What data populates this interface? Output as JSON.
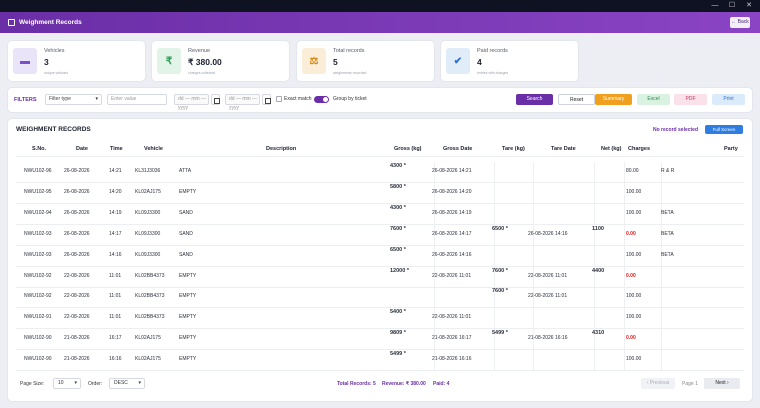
{
  "window": {
    "minimize": "—",
    "maximize": "☐",
    "close": "✕"
  },
  "app": {
    "title": "Weighment Records",
    "back_label": "← Back"
  },
  "cards": [
    {
      "label": "Vehicles",
      "value": "3",
      "sub": "unique vehicles",
      "icon": "truck-icon",
      "glyph": "▬",
      "bg": "#e9e4f7",
      "fg": "#7b4fc8"
    },
    {
      "label": "Revenue",
      "value": "₹ 380.00",
      "sub": "charges collected",
      "icon": "rupee-icon",
      "glyph": "₹",
      "bg": "#e2f3e7",
      "fg": "#2e9b55"
    },
    {
      "label": "Total records",
      "value": "5",
      "sub": "weighments recorded",
      "icon": "scale-icon",
      "glyph": "⚖",
      "bg": "#fbeed9",
      "fg": "#d98612"
    },
    {
      "label": "Paid records",
      "value": "4",
      "sub": "entries with charges",
      "icon": "check-badge-icon",
      "glyph": "✔",
      "bg": "#e1ecf9",
      "fg": "#2f6fd1"
    }
  ],
  "filters": {
    "label": "FILTERS",
    "type_placeholder": "Filter type",
    "value_placeholder": "Enter value",
    "date_from": "dd — mm — yyyy",
    "date_to": "dd — mm — yyyy",
    "exact_match": "Exact match",
    "group_by_ticket": "Group by ticket",
    "buttons": {
      "search": "Search",
      "reset": "Reset",
      "summary": "Summary",
      "excel": "Excel",
      "pdf": "PDF",
      "print": "Print"
    }
  },
  "table": {
    "title": "WEIGHMENT RECORDS",
    "no_record": "No record selected",
    "fullscreen": "Full Screen",
    "headers": [
      "S.No.",
      "Date",
      "Time",
      "Vehicle",
      "Description",
      "Gross (kg)",
      "Gross Date",
      "Tare (kg)",
      "Tare Date",
      "Net (kg)",
      "Charges",
      "Party"
    ],
    "rows": [
      {
        "sno": "NWU102-96",
        "date": "26-08-2026",
        "time": "14:21",
        "vehicle": "KL31J3036",
        "desc": "ATTA",
        "gross": "4300 *",
        "gross_date": "26-08-2026 14:21",
        "tare": "",
        "tare_date": "",
        "net": "",
        "charges": "80.00",
        "charges_red": false,
        "party": "R & R"
      },
      {
        "sno": "NWU102-95",
        "date": "26-08-2026",
        "time": "14:20",
        "vehicle": "KL02AJ175",
        "desc": "EMPTY",
        "gross": "5800 *",
        "gross_date": "26-08-2026 14:20",
        "tare": "",
        "tare_date": "",
        "net": "",
        "charges": "100.00",
        "charges_red": false,
        "party": ""
      },
      {
        "sno": "NWU102-94",
        "date": "26-08-2026",
        "time": "14:19",
        "vehicle": "KL09J3300",
        "desc": "SAND",
        "gross": "4300 *",
        "gross_date": "26-08-2026 14:19",
        "tare": "",
        "tare_date": "",
        "net": "",
        "charges": "100.00",
        "charges_red": false,
        "party": "BETA"
      },
      {
        "sno": "NWU102-93",
        "date": "26-08-2026",
        "time": "14:17",
        "vehicle": "KL09J3300",
        "desc": "SAND",
        "gross": "7600 *",
        "gross_date": "26-08-2026 14:17",
        "tare": "6500 *",
        "tare_date": "26-08-2026 14:16",
        "net": "1100",
        "charges": "0.00",
        "charges_red": true,
        "party": "BETA"
      },
      {
        "sno": "NWU102-93",
        "date": "26-08-2026",
        "time": "14:16",
        "vehicle": "KL09J3300",
        "desc": "SAND",
        "gross": "6500 *",
        "gross_date": "26-08-2026 14:16",
        "tare": "",
        "tare_date": "",
        "net": "",
        "charges": "100.00",
        "charges_red": false,
        "party": "BETA"
      },
      {
        "sno": "NWU102-92",
        "date": "22-08-2026",
        "time": "11:01",
        "vehicle": "KL02BB4373",
        "desc": "EMPTY",
        "gross": "12000 *",
        "gross_date": "22-08-2026 11:01",
        "tare": "7600 *",
        "tare_date": "22-08-2026 11:01",
        "net": "4400",
        "charges": "0.00",
        "charges_red": true,
        "party": ""
      },
      {
        "sno": "NWU102-92",
        "date": "22-08-2026",
        "time": "11:01",
        "vehicle": "KL02BB4373",
        "desc": "EMPTY",
        "gross": "",
        "gross_date": "",
        "tare": "7600 *",
        "tare_date": "22-08-2026 11:01",
        "net": "",
        "charges": "100.00",
        "charges_red": false,
        "party": ""
      },
      {
        "sno": "NWU102-91",
        "date": "22-08-2026",
        "time": "11:01",
        "vehicle": "KL02BB4373",
        "desc": "EMPTY",
        "gross": "5400 *",
        "gross_date": "22-08-2026 11:01",
        "tare": "",
        "tare_date": "",
        "net": "",
        "charges": "100.00",
        "charges_red": false,
        "party": ""
      },
      {
        "sno": "NWU102-90",
        "date": "21-08-2026",
        "time": "16:17",
        "vehicle": "KL02AJ175",
        "desc": "EMPTY",
        "gross": "9809 *",
        "gross_date": "21-08-2026 16:17",
        "tare": "5499 *",
        "tare_date": "21-08-2026 16:16",
        "net": "4310",
        "charges": "0.00",
        "charges_red": true,
        "party": ""
      },
      {
        "sno": "NWU102-90",
        "date": "21-08-2026",
        "time": "16:16",
        "vehicle": "KL02AJ175",
        "desc": "EMPTY",
        "gross": "5499 *",
        "gross_date": "21-08-2026 16:16",
        "tare": "",
        "tare_date": "",
        "net": "",
        "charges": "100.00",
        "charges_red": false,
        "party": ""
      }
    ]
  },
  "footer": {
    "page_size_label": "Page Size:",
    "page_size": "10",
    "order_label": "Order:",
    "order": "DESC",
    "total_records": "Total Records: 5",
    "revenue": "Revenue: ₹ 380.00",
    "paid": "Paid: 4",
    "previous": "‹ Previous",
    "page": "Page 1",
    "next": "Next ›"
  },
  "colors": {
    "accent": "#6a2ea6",
    "summary": "#f0a01e",
    "excel": "#d9f2e2",
    "pdf": "#fbe1ea",
    "print": "#dcebfb",
    "red": "#e01b1b"
  }
}
